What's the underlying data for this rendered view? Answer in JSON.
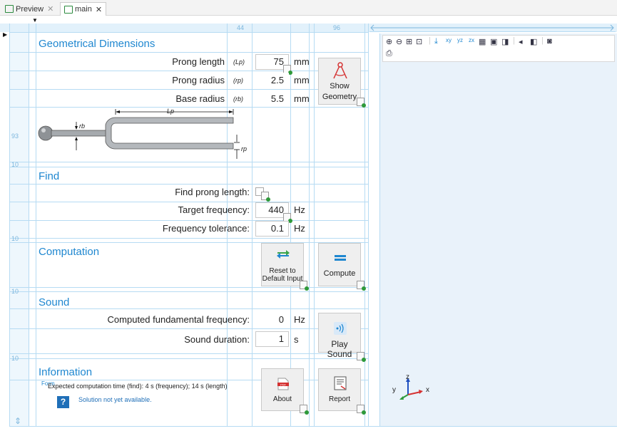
{
  "tabs": [
    {
      "label": "Preview"
    },
    {
      "label": "main"
    }
  ],
  "grid": {
    "column_numbers": [
      "44",
      "96"
    ],
    "row_numbers": [
      "93",
      "10",
      "10",
      "10",
      "10"
    ]
  },
  "geometry": {
    "title": "Geometrical Dimensions",
    "rows": [
      {
        "label": "Prong length",
        "symbol": "(Lp)",
        "value": "75",
        "unit": "mm"
      },
      {
        "label": "Prong radius",
        "symbol": "(rp)",
        "value": "2.5",
        "unit": "mm"
      },
      {
        "label": "Base radius",
        "symbol": "(rb)",
        "value": "5.5",
        "unit": "mm"
      }
    ],
    "show_button": "Show Geometry",
    "figure": {
      "lp": "Lp",
      "rb": "rb",
      "rp": "rp"
    }
  },
  "find": {
    "title": "Find",
    "find_prong_length": "Find prong length:",
    "target_frequency": {
      "label": "Target frequency:",
      "value": "440",
      "unit": "Hz"
    },
    "frequency_tolerance": {
      "label": "Frequency tolerance:",
      "value": "0.1",
      "unit": "Hz"
    }
  },
  "computation": {
    "title": "Computation",
    "reset_button": "Reset to Default Input",
    "compute_button": "Compute"
  },
  "sound": {
    "title": "Sound",
    "computed_frequency": {
      "label": "Computed fundamental frequency:",
      "value": "0",
      "unit": "Hz"
    },
    "duration": {
      "label": "Sound duration:",
      "value": "1",
      "unit": "s"
    },
    "play_button": "Play Sound"
  },
  "information": {
    "title": "Information",
    "overlap_text": "Form",
    "expected_time": "Expected computation time (find):  4 s (frequency); 14 s (length)",
    "solution_status": "Solution not yet available.",
    "about_button": "About",
    "report_button": "Report"
  },
  "graphics": {
    "axes": {
      "z": "z",
      "y": "y",
      "x": "x"
    }
  },
  "colors": {
    "accent": "#1f87d0",
    "grid_line": "#b6dbf3",
    "graphics_bg": "#e9f2fa",
    "compute_icon": "#1f87d0"
  }
}
